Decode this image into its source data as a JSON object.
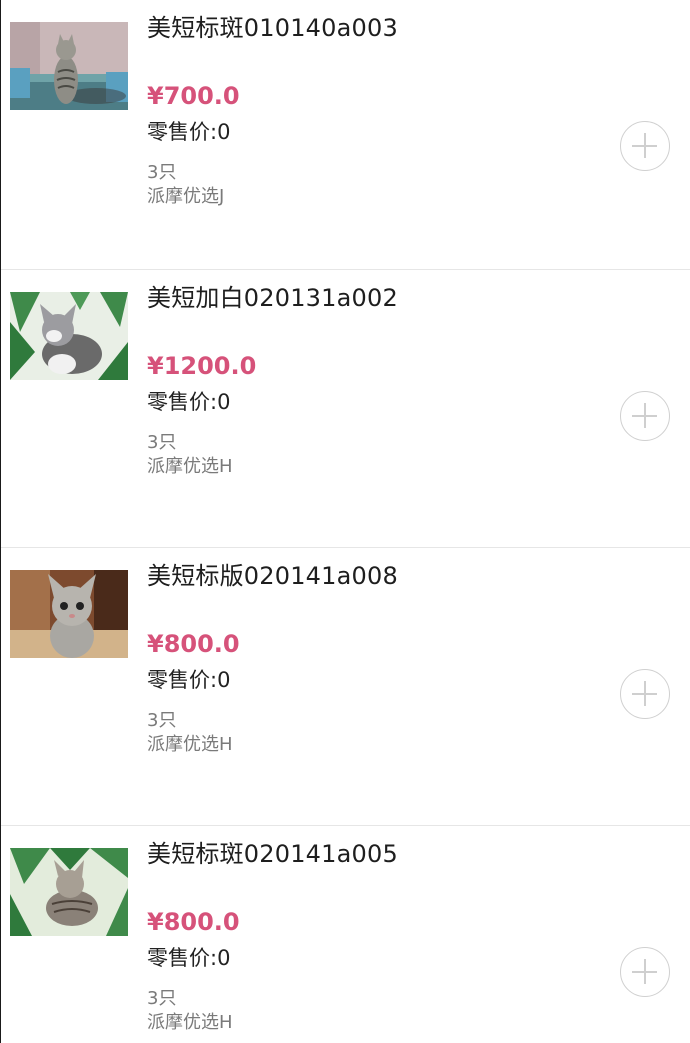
{
  "products": [
    {
      "title": "美短标斑010140a003",
      "price": "¥700.0",
      "retail": "零售价:0",
      "stock": "3只",
      "seller": "派摩优选J",
      "image_icon": "cat-photo"
    },
    {
      "title": "美短加白020131a002",
      "price": "¥1200.0",
      "retail": "零售价:0",
      "stock": "3只",
      "seller": "派摩优选H",
      "image_icon": "cat-photo"
    },
    {
      "title": "美短标版020141a008",
      "price": "¥800.0",
      "retail": "零售价:0",
      "stock": "3只",
      "seller": "派摩优选H",
      "image_icon": "cat-photo"
    },
    {
      "title": "美短标斑020141a005",
      "price": "¥800.0",
      "retail": "零售价:0",
      "stock": "3只",
      "seller": "派摩优选H",
      "image_icon": "cat-photo"
    }
  ],
  "colors": {
    "price": "#d6527a",
    "title": "#1e1e1e",
    "meta": "#7a7a7a",
    "add_button": "#d0d0d0"
  }
}
